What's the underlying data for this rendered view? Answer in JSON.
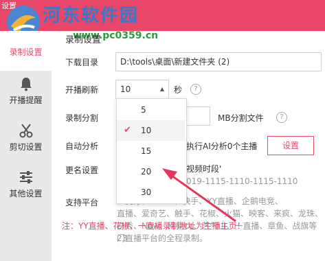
{
  "window": {
    "title": "设置"
  },
  "watermark": {
    "text": "河东软件园",
    "url": "www.pc0359.cn"
  },
  "sidebar": {
    "items": [
      {
        "label": "录制设置",
        "icon": "record-icon",
        "active": true
      },
      {
        "label": "开播提醒",
        "icon": "bell-icon",
        "active": false
      },
      {
        "label": "剪切设置",
        "icon": "scissors-icon",
        "active": false
      },
      {
        "label": "其他设置",
        "icon": "sliders-icon",
        "active": false
      }
    ]
  },
  "main": {
    "section_title": "录制设置",
    "download_dir": {
      "label": "下载目录",
      "value": "D:\\tools\\桌面\\新建文件夹 (2)"
    },
    "refresh": {
      "label": "开播刷新",
      "value": "10",
      "unit": "秒",
      "help": "?"
    },
    "split": {
      "label": "录制分割",
      "unit": "MB分割文件",
      "help": "?"
    },
    "auto_analyze": {
      "label": "自动分析",
      "text": "执行AI分析0个主播",
      "button": "设置"
    },
    "rename": {
      "label": "更名设置",
      "line1": "视频时段'",
      "line2": "019-1115-1110-1115-1110"
    },
    "platforms": {
      "label": "支持平台",
      "lines": [
        "、虎牙、bilibili、快手、YY直播、企鹅电竞、",
        "直播、爱奇艺、触手、花椒、火猫、映客、来疯、龙珠、",
        "奇秀、Now、网易cc、艺气山、一直播、章鱼、战旗等23",
        "门直播平台的全程录制。"
      ]
    },
    "note": "注：YY直播、花椒、一直播录制地址为主播主页！"
  },
  "dropdown": {
    "options": [
      "5",
      "10",
      "15",
      "20",
      "30"
    ],
    "selected": "10"
  },
  "colors": {
    "accent": "#e8476a",
    "sidebar_bg": "#e9e9ec",
    "arrow": "#e8345a"
  }
}
